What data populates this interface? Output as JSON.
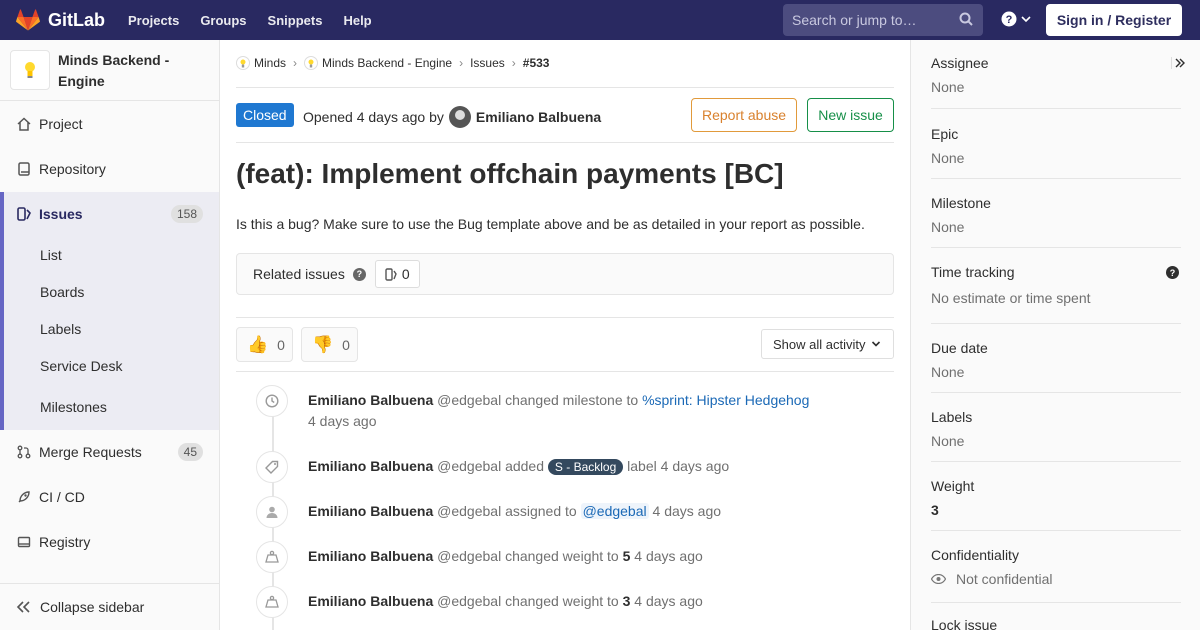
{
  "topnav": {
    "brand": "GitLab",
    "links": [
      "Projects",
      "Groups",
      "Snippets",
      "Help"
    ],
    "search_placeholder": "Search or jump to…",
    "signin": "Sign in / Register"
  },
  "sidebar": {
    "project_name": "Minds Backend - Engine",
    "items": {
      "project": "Project",
      "repository": "Repository",
      "issues": "Issues",
      "issues_count": "158",
      "merge_requests": "Merge Requests",
      "mr_count": "45",
      "cicd": "CI / CD",
      "registry": "Registry"
    },
    "sub_items": [
      "List",
      "Boards",
      "Labels",
      "Service Desk",
      "Milestones"
    ],
    "collapse": "Collapse sidebar"
  },
  "breadcrumb": [
    "Minds",
    "Minds Backend - Engine",
    "Issues",
    "#533"
  ],
  "issue": {
    "status": "Closed",
    "opened_prefix": "Opened",
    "opened_time": "4 days ago",
    "opened_by": "by",
    "author": "Emiliano Balbuena",
    "report_abuse": "Report abuse",
    "new_issue": "New issue",
    "title": "(feat): Implement offchain payments [BC]",
    "description": "Is this a bug? Make sure to use the Bug template above and be as detailed in your report as possible.",
    "related_label": "Related issues",
    "related_count": "0",
    "thumbs_up": "0",
    "thumbs_down": "0",
    "show_activity": "Show all activity"
  },
  "activity": [
    {
      "author": "Emiliano Balbuena",
      "handle": "@edgebal",
      "action": "changed milestone to",
      "target": "%sprint: Hipster Hedgehog",
      "time": "4 days ago",
      "icon": "clock-icon"
    },
    {
      "author": "Emiliano Balbuena",
      "handle": "@edgebal",
      "action": "added",
      "label": "S - Backlog",
      "after": "label",
      "time": "4 days ago",
      "icon": "tag-icon"
    },
    {
      "author": "Emiliano Balbuena",
      "handle": "@edgebal",
      "action": "assigned to",
      "mention": "@edgebal",
      "time": "4 days ago",
      "icon": "user-icon"
    },
    {
      "author": "Emiliano Balbuena",
      "handle": "@edgebal",
      "action": "changed weight to",
      "value": "5",
      "time": "4 days ago",
      "icon": "weight-icon"
    },
    {
      "author": "Emiliano Balbuena",
      "handle": "@edgebal",
      "action": "changed weight to",
      "value": "3",
      "time": "4 days ago",
      "icon": "weight-icon"
    }
  ],
  "right_sidebar": {
    "assignee": {
      "label": "Assignee",
      "value": "None"
    },
    "epic": {
      "label": "Epic",
      "value": "None"
    },
    "milestone": {
      "label": "Milestone",
      "value": "None"
    },
    "time_tracking": {
      "label": "Time tracking",
      "value": "No estimate or time spent"
    },
    "due_date": {
      "label": "Due date",
      "value": "None"
    },
    "labels": {
      "label": "Labels",
      "value": "None"
    },
    "weight": {
      "label": "Weight",
      "value": "3"
    },
    "confidentiality": {
      "label": "Confidentiality",
      "value": "Not confidential"
    },
    "lock": {
      "label": "Lock issue"
    }
  },
  "colors": {
    "nav": "#292961",
    "closed": "#1f78d1",
    "abuse": "#e19a3b",
    "new_issue": "#168f48",
    "label": "#34495e"
  }
}
